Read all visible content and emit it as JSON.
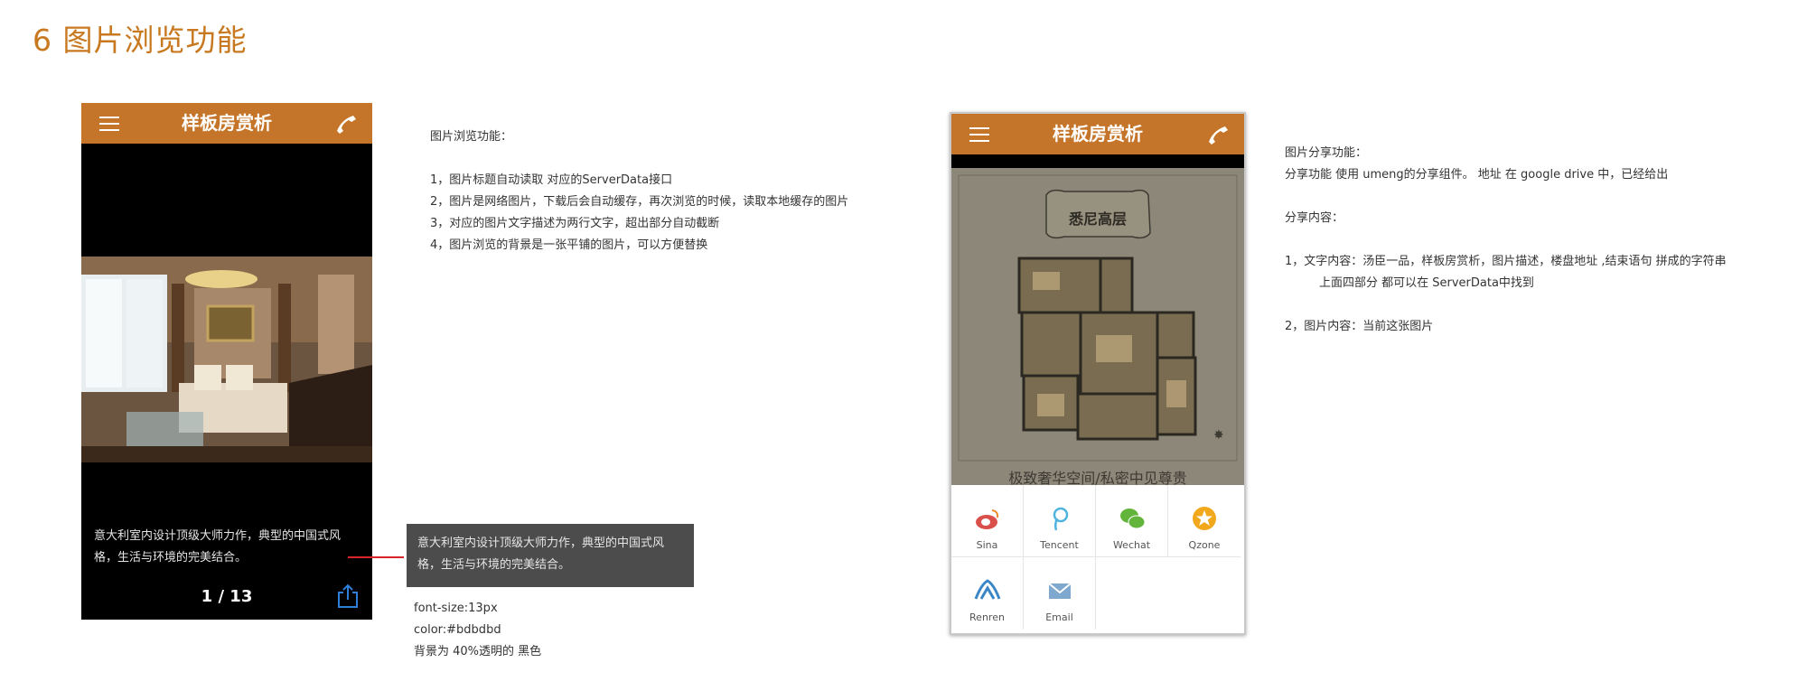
{
  "page_title": "6 图片浏览功能",
  "phone1": {
    "nav_title": "样板房赏析",
    "caption_line1": "意大利室内设计顶级大师力作，典型的中国式风",
    "caption_line2": "格，生活与环境的完美结合。",
    "counter": "1 / 13"
  },
  "caption_sample": {
    "line1": "意大利室内设计顶级大师力作，典型的中国式风",
    "line2": "格，生活与环境的完美结合。"
  },
  "style_notes": [
    "font-size:13px",
    "color:#bdbdbd",
    "背景为 40%透明的 黑色"
  ],
  "desc1": {
    "title": "图片浏览功能：",
    "items": [
      "1，图片标题自动读取 对应的ServerData接口",
      "2，图片是网络图片，下载后会自动缓存，再次浏览的时候，读取本地缓存的图片",
      "3，对应的图片文字描述为两行文字，超出部分自动截断",
      "4，图片浏览的背景是一张平铺的图片，可以方便替换"
    ]
  },
  "phone2": {
    "nav_title": "样板房赏析",
    "plan_heading": "悉尼高层",
    "floor_caption": "极致奢华空间/私密中见尊贵",
    "share_items": [
      {
        "label": "Sina",
        "icon": "sina-weibo-icon"
      },
      {
        "label": "Tencent",
        "icon": "tencent-weibo-icon"
      },
      {
        "label": "Wechat",
        "icon": "wechat-icon"
      },
      {
        "label": "Qzone",
        "icon": "qzone-icon"
      },
      {
        "label": "Renren",
        "icon": "renren-icon"
      },
      {
        "label": "Email",
        "icon": "email-icon"
      }
    ]
  },
  "desc2": {
    "title": "图片分享功能：",
    "line1": "分享功能 使用 umeng的分享组件。 地址 在 google drive 中，已经给出",
    "content_title": "分享内容：",
    "item1": "1，文字内容：汤臣一品，样板房赏析，图片描述，楼盘地址 ,结束语句  拼成的字符串",
    "item1_cont": "上面四部分 都可以在 ServerData中找到",
    "item2": "2，图片内容：当前这张图片"
  },
  "colors": {
    "accent": "#c57529",
    "title": "#c8791f",
    "connector": "#d9252a",
    "share_blue": "#2f7fd8"
  }
}
